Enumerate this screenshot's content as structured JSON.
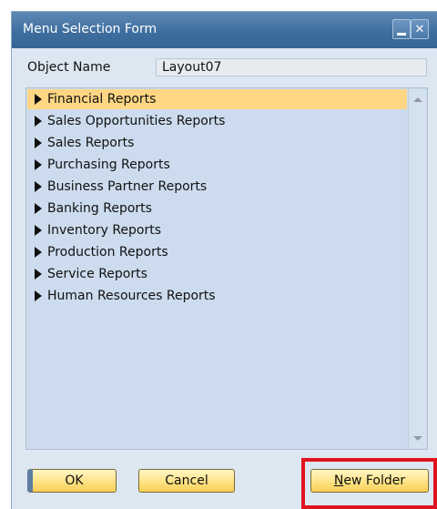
{
  "window": {
    "title": "Menu Selection Form"
  },
  "form": {
    "object_name_label": "Object Name",
    "object_name_value": "Layout07"
  },
  "list": {
    "items": [
      {
        "label": "Financial Reports",
        "selected": true
      },
      {
        "label": "Sales Opportunities Reports",
        "selected": false
      },
      {
        "label": "Sales Reports",
        "selected": false
      },
      {
        "label": "Purchasing Reports",
        "selected": false
      },
      {
        "label": "Business Partner Reports",
        "selected": false
      },
      {
        "label": "Banking Reports",
        "selected": false
      },
      {
        "label": "Inventory Reports",
        "selected": false
      },
      {
        "label": "Production Reports",
        "selected": false
      },
      {
        "label": "Service Reports",
        "selected": false
      },
      {
        "label": "Human Resources Reports",
        "selected": false
      }
    ]
  },
  "buttons": {
    "ok_label": "OK",
    "cancel_label": "Cancel",
    "new_folder_mnemonic": "N",
    "new_folder_rest": "ew Folder"
  },
  "colors": {
    "selected_row": "#ffd784",
    "titlebar": "#3e6e9f",
    "highlight": "#e0141e"
  }
}
